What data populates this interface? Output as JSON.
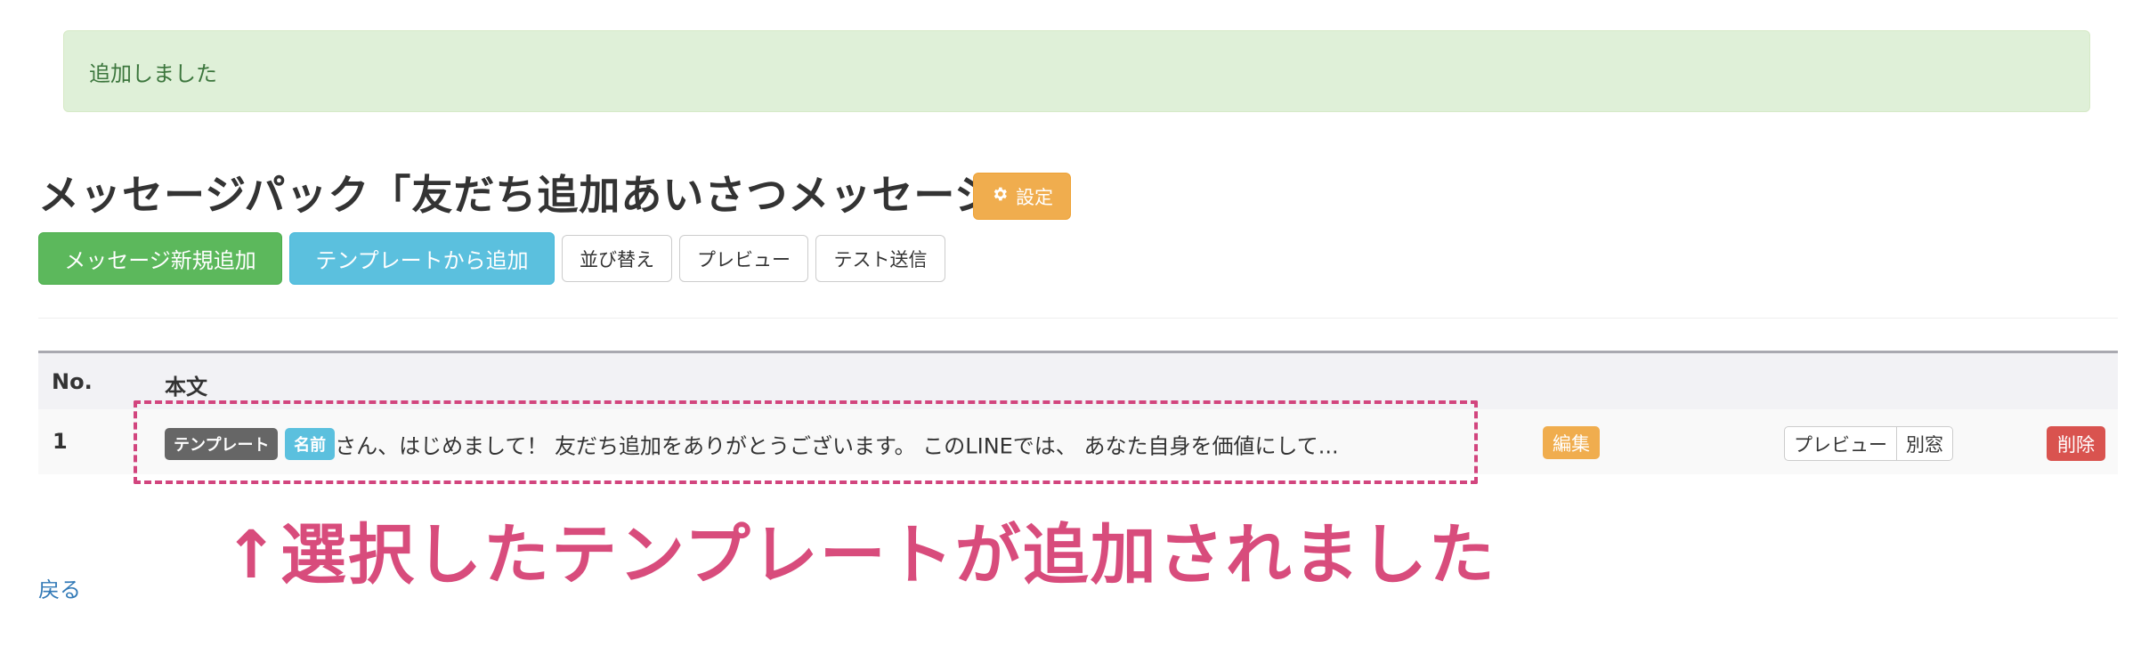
{
  "alert": {
    "message": "追加しました"
  },
  "page": {
    "title": "メッセージパック「友だち追加あいさつメッセージ」",
    "settings_label": "設定"
  },
  "toolbar": {
    "new_message_label": "メッセージ新規追加",
    "from_template_label": "テンプレートから追加",
    "sort_label": "並び替え",
    "preview_label": "プレビュー",
    "test_send_label": "テスト送信"
  },
  "table": {
    "headers": {
      "no": "No.",
      "body": "本文"
    },
    "rows": [
      {
        "no": "1",
        "tag_template": "テンプレート",
        "tag_name": "名前",
        "text": "さん、はじめまして！ 友だち追加をありがとうございます。 このLINEでは、 あなた自身を価値にして...",
        "edit_label": "編集",
        "preview_label": "プレビュー",
        "new_window_label": "別窓",
        "delete_label": "削除"
      }
    ]
  },
  "annotation": {
    "text": "↑選択したテンプレートが追加されました"
  },
  "footer": {
    "back_label": "戻る"
  },
  "colors": {
    "success_bg": "#dff0d8",
    "warning": "#f0ad4e",
    "success_btn": "#5cb85c",
    "info_btn": "#5bc0de",
    "danger": "#d9534f",
    "annotation": "#d84c7c",
    "link": "#337ab7"
  },
  "icons": {
    "settings": "gear-icon"
  }
}
